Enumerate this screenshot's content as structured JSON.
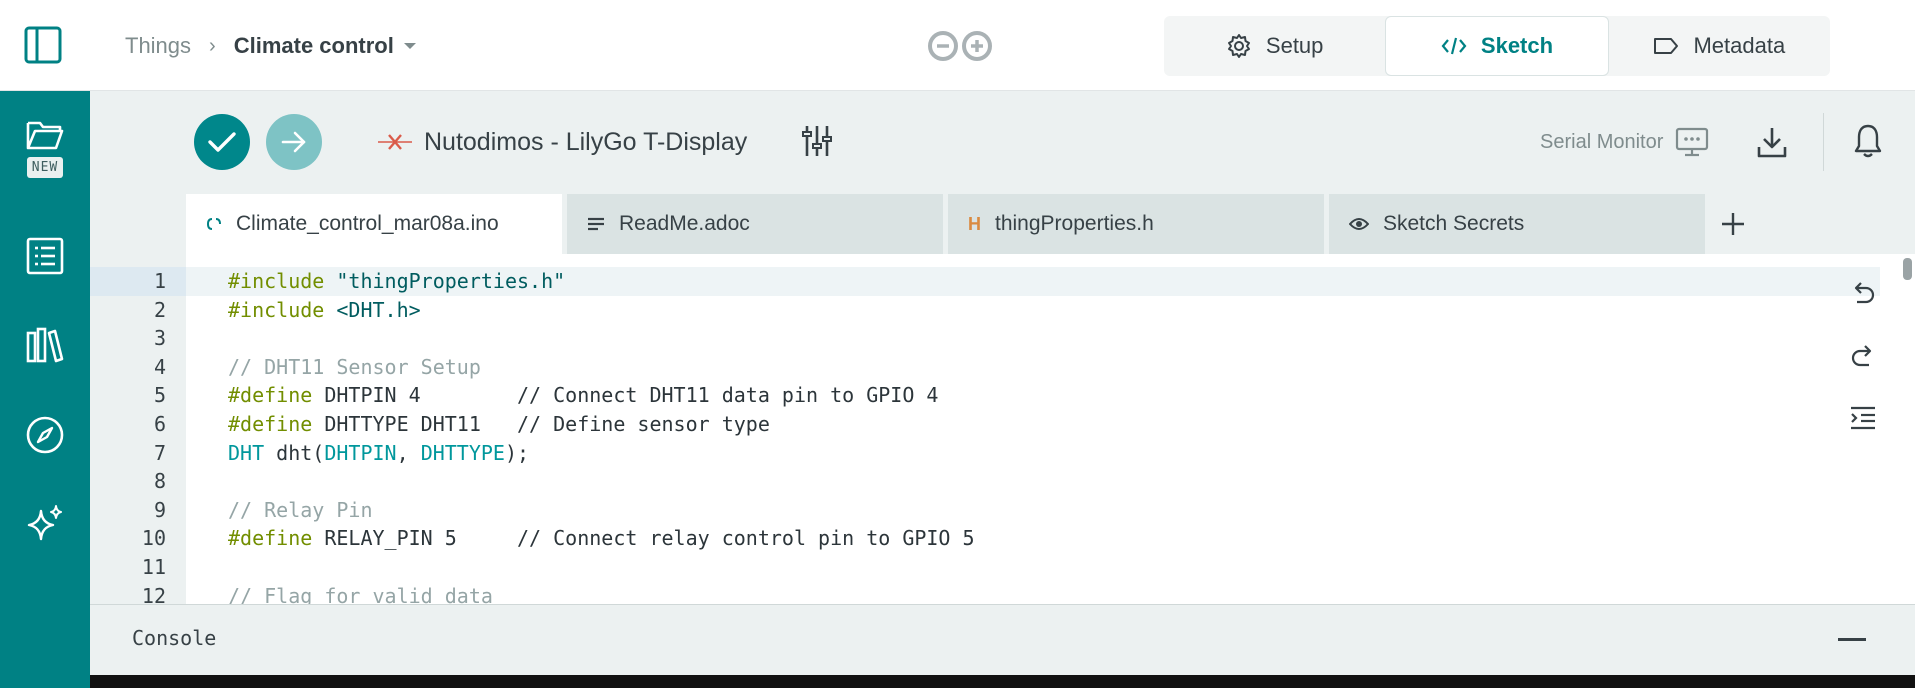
{
  "breadcrumb": {
    "root": "Things",
    "separator": "›",
    "current": "Climate control"
  },
  "mode_tabs": [
    {
      "label": "Setup",
      "icon": "gear-icon",
      "active": false
    },
    {
      "label": "Sketch",
      "icon": "code-icon",
      "active": true
    },
    {
      "label": "Metadata",
      "icon": "tag-icon",
      "active": false
    }
  ],
  "rail": {
    "new_badge": "NEW"
  },
  "toolbar": {
    "device_name": "Nutodimos - LilyGo T-Display",
    "serial_monitor": "Serial Monitor"
  },
  "file_tabs": [
    {
      "label": "Climate_control_mar08a.ino",
      "icon": "code-file-icon",
      "active": true
    },
    {
      "label": "ReadMe.adoc",
      "icon": "text-lines-icon",
      "active": false
    },
    {
      "label": "thingProperties.h",
      "icon": "header-file-icon",
      "active": false
    },
    {
      "label": "Sketch Secrets",
      "icon": "eye-icon",
      "active": false
    }
  ],
  "editor": {
    "line_numbers": [
      "1",
      "2",
      "3",
      "4",
      "5",
      "6",
      "7",
      "8",
      "9",
      "10",
      "11",
      "12"
    ],
    "code": {
      "l1_kw": "#include",
      "l1_str": " \"thingProperties.h\"",
      "l2_kw": "#include",
      "l2_str": " <DHT.h>",
      "l4_cm": "// DHT11 Sensor Setup",
      "l5_kw": "#define",
      "l5_rest": " DHTPIN 4        ",
      "l5_cm": "// Connect DHT11 data pin to GPIO 4",
      "l6_kw": "#define",
      "l6_rest": " DHTTYPE DHT11   ",
      "l6_cm": "// Define sensor type",
      "l7_ty": "DHT",
      "l7_a": " dht(",
      "l7_b": "DHTPIN",
      "l7_c": ", ",
      "l7_d": "DHTTYPE",
      "l7_e": ");",
      "l9_cm": "// Relay Pin",
      "l10_kw": "#define",
      "l10_rest": " RELAY_PIN 5     ",
      "l10_cm": "// Connect relay control pin to GPIO 5",
      "l12_cm": "// Flag for valid data"
    }
  },
  "console": {
    "title": "Console"
  },
  "colors": {
    "brand_teal": "#008184",
    "verify": "#00878b",
    "upload": "#7ec3c5",
    "device_error": "#da5b4a"
  }
}
